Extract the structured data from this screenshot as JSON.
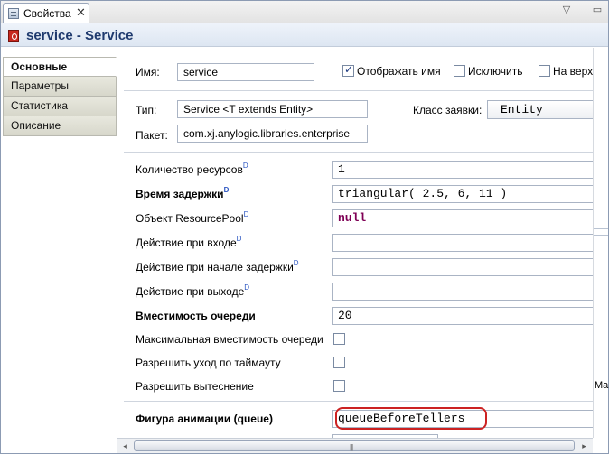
{
  "tab": {
    "label": "Свойства",
    "close": "✕"
  },
  "window_controls": {
    "menu": "▽",
    "minimize": "▭"
  },
  "header": {
    "title": "service - Service"
  },
  "categories": [
    {
      "label": "Основные"
    },
    {
      "label": "Параметры"
    },
    {
      "label": "Статистика"
    },
    {
      "label": "Описание"
    }
  ],
  "name_row": {
    "label": "Имя:",
    "value": "service",
    "show_name_label": "Отображать имя",
    "show_name_checked": true,
    "exclude_label": "Исключить",
    "exclude_checked": false,
    "on_top_label": "На верх",
    "on_top_checked": false
  },
  "type_row": {
    "label": "Тип:",
    "value": "Service <T extends Entity>",
    "request_class_label": "Класс заявки:",
    "request_class_value": "Entity"
  },
  "package_row": {
    "label": "Пакет:",
    "value": "com.xj.anylogic.libraries.enterprise"
  },
  "properties": [
    {
      "label": "Количество ресурсов",
      "dyn": "D",
      "bold": false,
      "value": "1"
    },
    {
      "label": "Время задержки",
      "dyn": "D",
      "bold": true,
      "value": "triangular( 2.5, 6, 11 )"
    },
    {
      "label": "Объект ResourcePool",
      "dyn": "D",
      "bold": false,
      "value": "null",
      "keyword": true
    },
    {
      "label": "Действие при входе",
      "dyn": "D",
      "bold": false,
      "value": ""
    },
    {
      "label": "Действие при начале задержки",
      "dyn": "D",
      "bold": false,
      "value": ""
    },
    {
      "label": "Действие при выходе",
      "dyn": "D",
      "bold": false,
      "value": ""
    },
    {
      "label": "Вместимость очереди",
      "dyn": "",
      "bold": true,
      "value": "20"
    }
  ],
  "checkbox_props": [
    {
      "label": "Максимальная вместимость очереди",
      "checked": false
    },
    {
      "label": "Разрешить уход по таймауту",
      "checked": false
    },
    {
      "label": "Разрешить вытеснение",
      "checked": false
    }
  ],
  "animation": {
    "label": "Фигура анимации (queue)",
    "value": "queueBeforeTellers"
  },
  "right_strip": {
    "fragment": "Mai"
  },
  "scrollbar": {
    "left_arrow": "◂",
    "right_arrow": "▸",
    "grip": "|||"
  },
  "colors": {
    "header_title": "#1f3a6e",
    "keyword": "#7f0055",
    "highlight": "#cc2222"
  }
}
